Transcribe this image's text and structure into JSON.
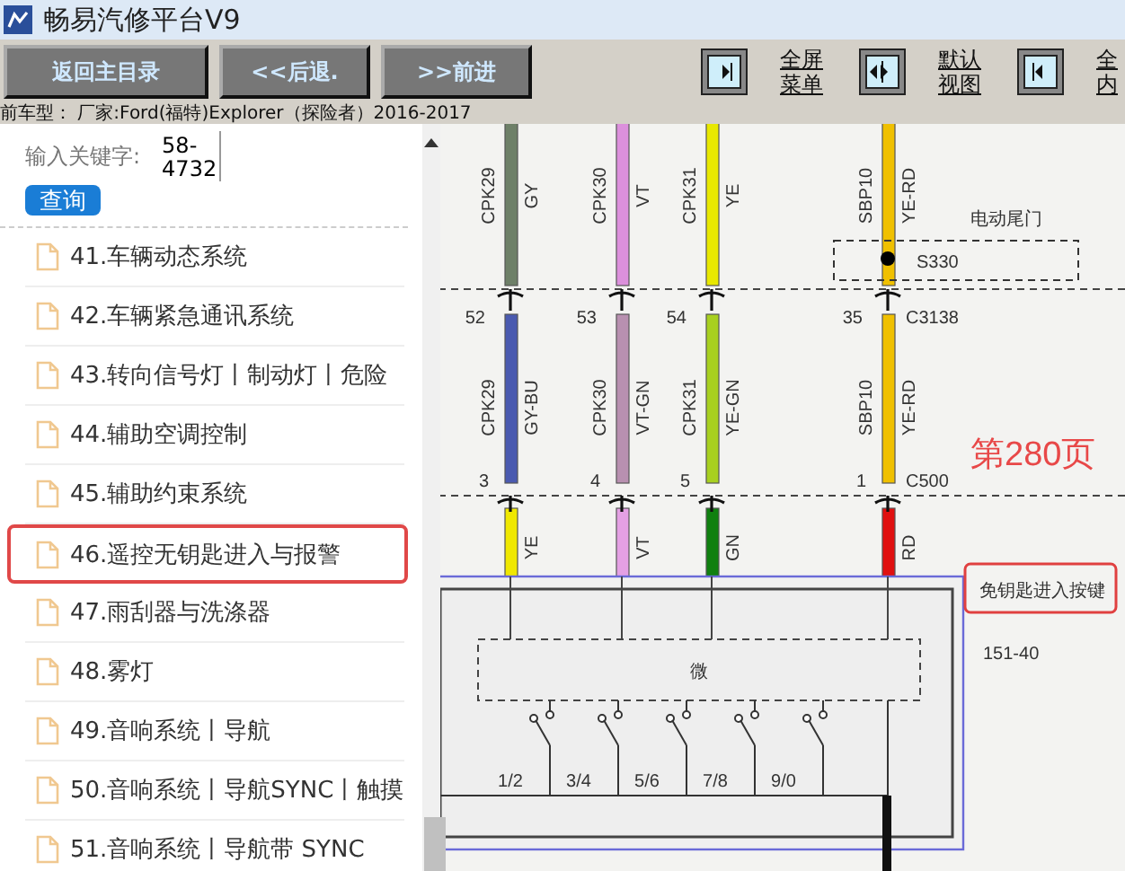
{
  "window": {
    "title": "畅易汽修平台V9"
  },
  "toolbar": {
    "nav_buttons": [
      {
        "label": "返回主目录"
      },
      {
        "label": "<<后退."
      },
      {
        "label": ">>前进"
      }
    ],
    "view_buttons": [
      {
        "kind": "right",
        "lines": [
          "全屏",
          "菜单"
        ]
      },
      {
        "kind": "both",
        "lines": [
          "默认",
          "视图"
        ]
      },
      {
        "kind": "left",
        "lines": [
          "全",
          "内"
        ]
      }
    ]
  },
  "car_model": "前车型： 厂家:Ford(福特)Explorer（探险者）2016-2017",
  "search": {
    "label": "输入关键字:",
    "value": "58-4732",
    "button": "查询"
  },
  "sidebar": {
    "items": [
      {
        "label": "41.车辆动态系统",
        "selected": false
      },
      {
        "label": "42.车辆紧急通讯系统",
        "selected": false
      },
      {
        "label": "43.转向信号灯丨制动灯丨危险",
        "selected": false
      },
      {
        "label": "44.辅助空调控制",
        "selected": false
      },
      {
        "label": "45.辅助约束系统",
        "selected": false
      },
      {
        "label": "46.遥控无钥匙进入与报警",
        "selected": true
      },
      {
        "label": "47.雨刮器与洗涤器",
        "selected": false
      },
      {
        "label": "48.雾灯",
        "selected": false
      },
      {
        "label": "49.音响系统丨导航",
        "selected": false
      },
      {
        "label": "50.音响系统丨导航SYNC丨触摸",
        "selected": false
      },
      {
        "label": "51.音响系统丨导航带 SYNC",
        "selected": false
      }
    ]
  },
  "diagram": {
    "wires": [
      {
        "mid_pin": "52",
        "bottom_pin": "3",
        "segments": [
          {
            "circuit": "CPK29",
            "code": "GY",
            "color": "#6e8068"
          },
          {
            "circuit": "CPK29",
            "code": "GY-BU",
            "color": "#4a5ab0"
          },
          {
            "code": "YE",
            "color": "#f0e800"
          }
        ]
      },
      {
        "mid_pin": "53",
        "bottom_pin": "4",
        "segments": [
          {
            "circuit": "CPK30",
            "code": "VT",
            "color": "#dc90dc"
          },
          {
            "circuit": "CPK30",
            "code": "VT-GN",
            "color": "#b890b0"
          },
          {
            "code": "VT",
            "color": "#e4a0e4"
          }
        ]
      },
      {
        "mid_pin": "54",
        "bottom_pin": "5",
        "segments": [
          {
            "circuit": "CPK31",
            "code": "YE",
            "color": "#e8e800"
          },
          {
            "circuit": "CPK31",
            "code": "YE-GN",
            "color": "#a8d020"
          },
          {
            "code": "GN",
            "color": "#108010"
          }
        ]
      },
      {
        "mid_pin": "35",
        "bottom_pin": "1",
        "segments": [
          {
            "circuit": "SBP10",
            "code": "YE-RD",
            "color": "#f0c000"
          },
          {
            "circuit": "SBP10",
            "code": "YE-RD",
            "color": "#f0c000"
          },
          {
            "code": "RD",
            "color": "#e01010"
          }
        ]
      }
    ],
    "mid_connector": "C3138",
    "bottom_connector": "C500",
    "splice": {
      "caption": "电动尾门",
      "name": "S330"
    },
    "page_label": "第280页",
    "module": {
      "name": "免钥匙进入按键",
      "code": "151-40",
      "inner_label": "微",
      "switches": [
        "1/2",
        "3/4",
        "5/6",
        "7/8",
        "9/0"
      ]
    }
  }
}
